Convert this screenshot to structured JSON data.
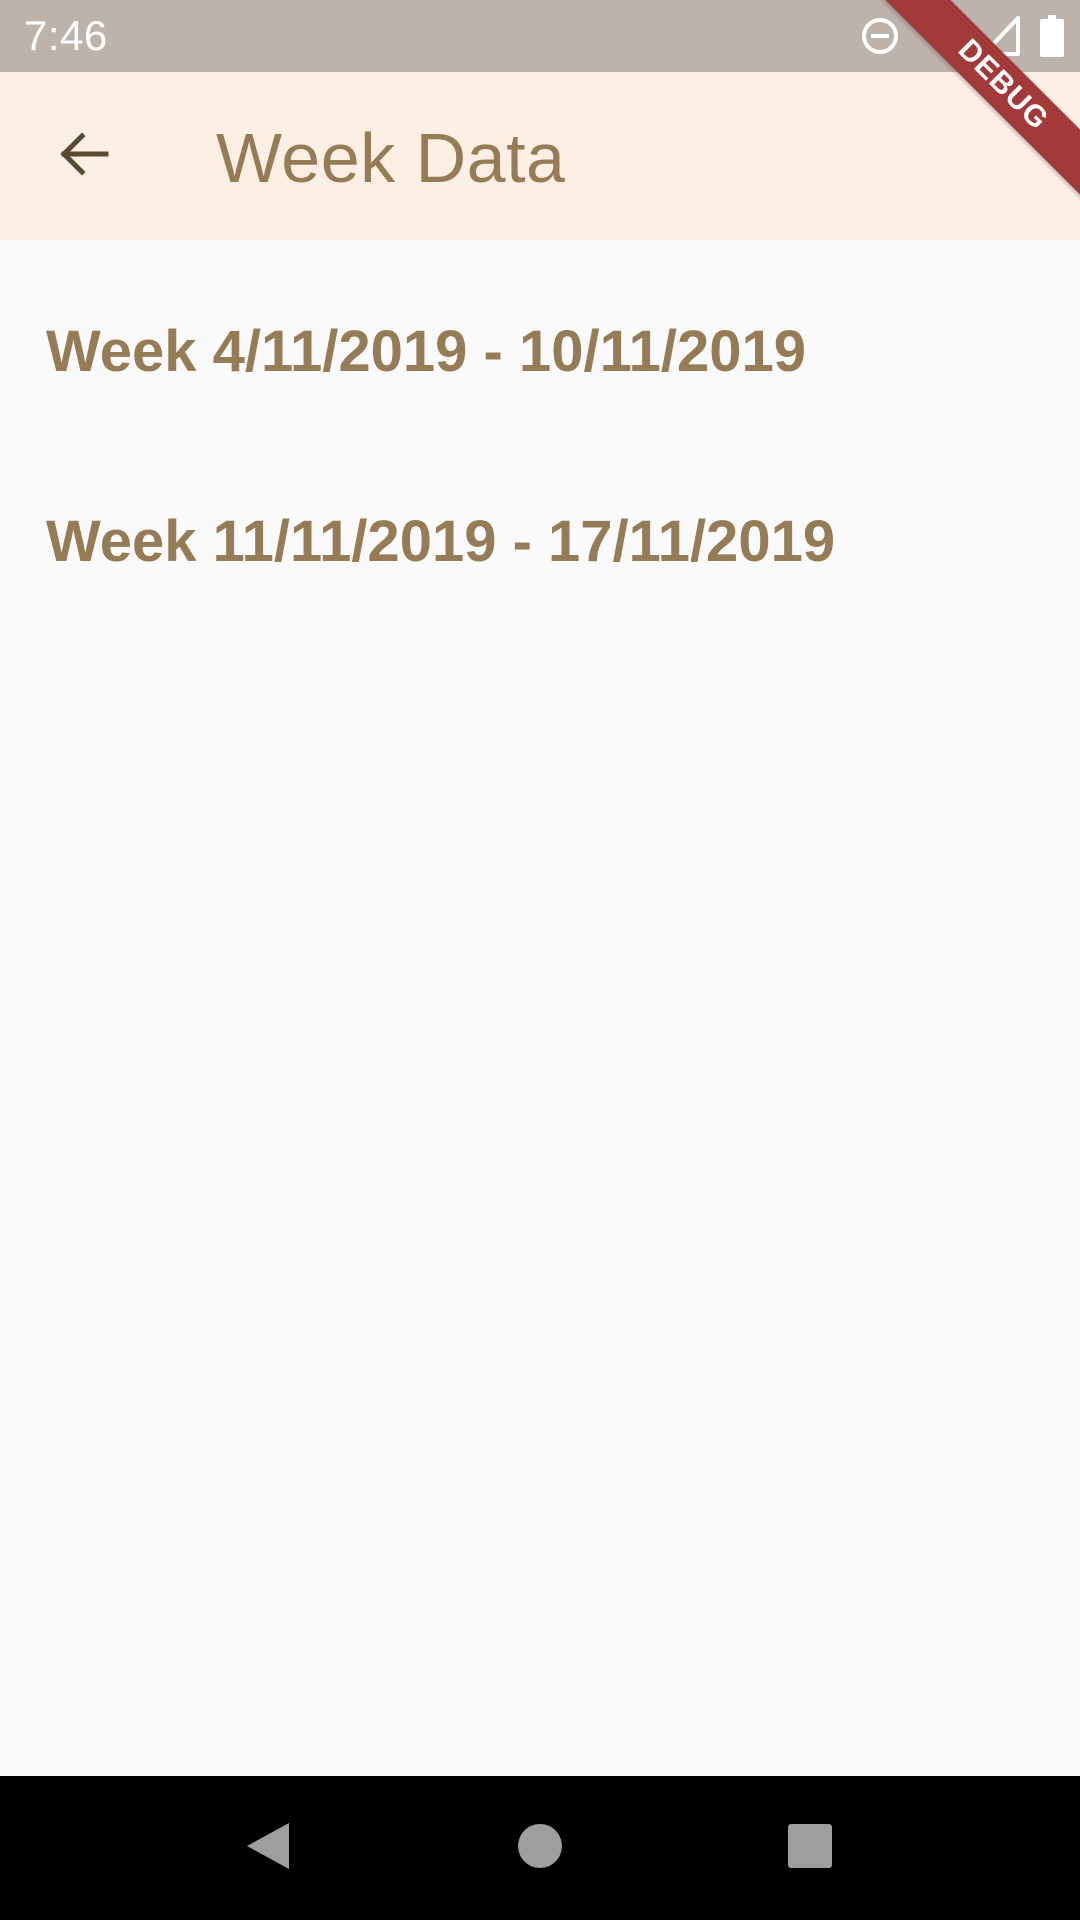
{
  "status_bar": {
    "time": "7:46",
    "icons": [
      "do-not-disturb-icon",
      "wifi-icon",
      "signal-icon",
      "battery-icon"
    ]
  },
  "app_bar": {
    "title": "Week Data",
    "back_icon": "arrow-back-icon",
    "background": "#feefe5"
  },
  "debug_banner": {
    "label": "DEBUG"
  },
  "weeks": [
    {
      "label": "Week 4/11/2019 - 10/11/2019"
    },
    {
      "label": "Week 11/11/2019 - 17/11/2019"
    }
  ],
  "nav_bar": {
    "icons": [
      "nav-back-icon",
      "nav-home-icon",
      "nav-recents-icon"
    ]
  },
  "colors": {
    "accent_text": "#957b56",
    "status_bar": "#beb3ab",
    "ribbon": "#a23a3a"
  }
}
